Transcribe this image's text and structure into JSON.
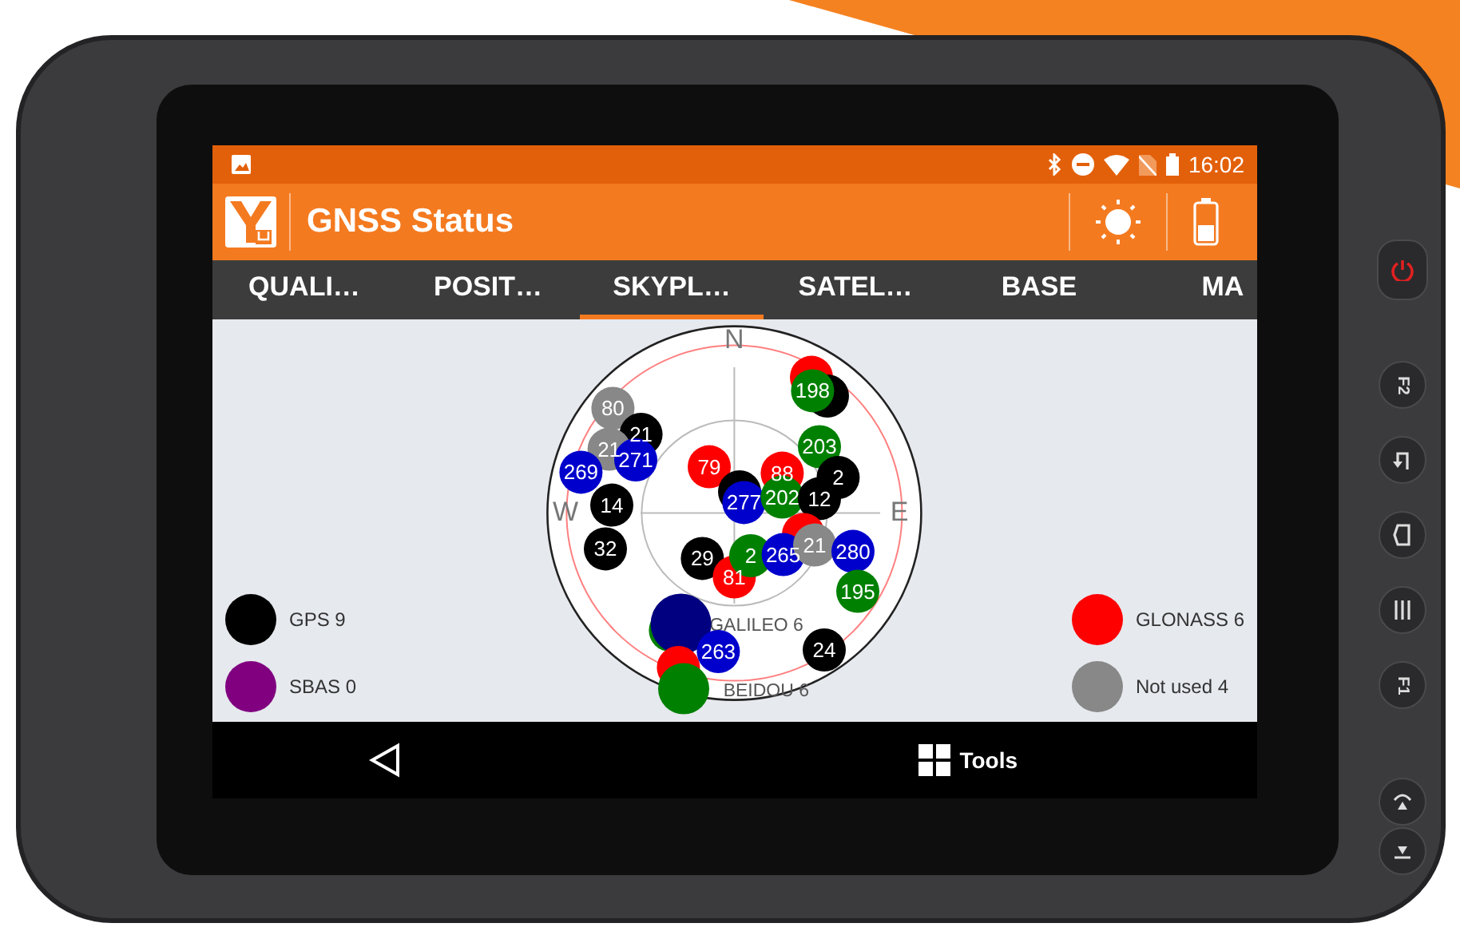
{
  "status_bar": {
    "time": "16:02"
  },
  "app_bar": {
    "title": "GNSS Status"
  },
  "tabs": [
    {
      "label": "QUALI…",
      "selected": false
    },
    {
      "label": "POSIT…",
      "selected": false
    },
    {
      "label": "SKYPL…",
      "selected": true
    },
    {
      "label": "SATEL…",
      "selected": false
    },
    {
      "label": "BASE",
      "selected": false
    },
    {
      "label": "MA",
      "selected": false
    }
  ],
  "skyplot": {
    "directions": [
      "N",
      "W",
      "E"
    ],
    "constellation_labels": [
      "GALILEO 6",
      "BEIDOU 6"
    ],
    "satellites": [
      {
        "color": "#ff0000"
      },
      {
        "color": "#000000"
      },
      {
        "label": "198",
        "color": "#008000"
      },
      {
        "label": "80",
        "color": "#888888"
      },
      {
        "label": "21",
        "color": "#000000"
      },
      {
        "label": "21",
        "color": "#888888"
      },
      {
        "label": "271",
        "color": "#0000cc"
      },
      {
        "label": "269",
        "color": "#0000cc"
      },
      {
        "label": "79",
        "color": "#ff0000"
      },
      {
        "label": "203",
        "color": "#008000"
      },
      {
        "label": "88",
        "color": "#ff0000"
      },
      {
        "label": "2",
        "color": "#000000"
      },
      {
        "color": "#000000"
      },
      {
        "label": "277",
        "color": "#0000cc"
      },
      {
        "label": "202",
        "color": "#008000"
      },
      {
        "label": "12",
        "color": "#000000"
      },
      {
        "label": "14",
        "color": "#000000"
      },
      {
        "label": "32",
        "color": "#000000"
      },
      {
        "label": "29",
        "color": "#000000"
      },
      {
        "label": "81",
        "color": "#ff0000"
      },
      {
        "color": "#ff0000"
      },
      {
        "label": "2",
        "color": "#008000"
      },
      {
        "label": "265",
        "color": "#0000cc"
      },
      {
        "label": "21",
        "color": "#888888"
      },
      {
        "label": "280",
        "color": "#0000cc"
      },
      {
        "label": "195",
        "color": "#008000"
      },
      {
        "color": "#008000"
      },
      {
        "color": "#000080"
      },
      {
        "color": "#ff0000"
      },
      {
        "label": "263",
        "color": "#0000cc"
      },
      {
        "color": "#008000"
      },
      {
        "label": "24",
        "color": "#000000"
      }
    ]
  },
  "legend_left": [
    {
      "label": "GPS 9",
      "color": "#000000"
    },
    {
      "label": "SBAS 0",
      "color": "#800080"
    }
  ],
  "legend_right": [
    {
      "label": "GLONASS 6",
      "color": "#ff0000"
    },
    {
      "label": "Not used 4",
      "color": "#888888"
    }
  ],
  "nav_bar": {
    "tools": "Tools"
  },
  "device_keys": [
    {
      "kind": "power"
    },
    {
      "kind": "fn",
      "label": "F2"
    },
    {
      "kind": "back"
    },
    {
      "kind": "home"
    },
    {
      "kind": "menu"
    },
    {
      "kind": "fn",
      "label": "F1"
    },
    {
      "kind": "volup"
    },
    {
      "kind": "voldown"
    }
  ]
}
